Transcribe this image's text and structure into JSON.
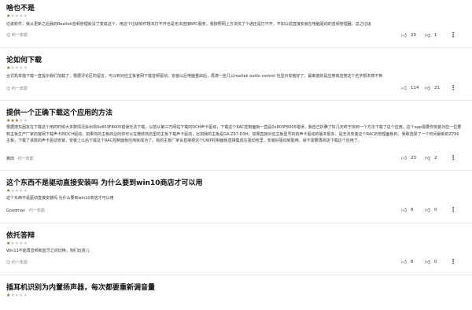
{
  "reviews": [
    {
      "title": "啥也不是",
      "rating": 1,
      "body": "垃圾软件，我从更新之后我的Realtek音频管理就没了变成这个，用这个垃圾软件根本打不开也是无法连接RPC服务，我按照网上方法找了个通还是打不开，不如以前直接安装在电脑驱动的音频管理器，总之垃圾",
      "author": "",
      "time": "约一年前",
      "likes": "20",
      "dislikes": "1"
    },
    {
      "title": "论如何下载",
      "rating": 1,
      "body": "台式机单独下载一直提示我们加载了，根据评论区的留言，可以到对应主板官网下载音频驱动，安装以后电脑重启后，再搜一些几公realtek audio control 也显示安装好了。最离谱的是应用商店搜这个名字根本搜不到",
      "author": "",
      "time": "约一年前",
      "likes": "114",
      "dislikes": "21"
    },
    {
      "title": "提供一个正确下载这个应用的方法",
      "rating": 3,
      "body": "根据搜东困友在下载这个用的时候大多数情况会出现0x803F8005错误无法下载，以前从第三方网站下载的DCH声卡驱动，下载这个RAC控制面板一直是0x803F8005错误，我自己折腾了好几天终于找到一个方法下载了这个应用。这个app需要你安装对应一位要到主板生产厂家的官网下载声卡的DCH驱动，如果你的主板商业的你可以在微软商店里的主板下载声卡驱动，比如我的主板是GA-Z97-D3H，如果直接对应主板型号的的声卡驱动的版本很多，是无法安装这个RAC的管理面板的，我取选择了一个时间最新的Z790主板，下载了该款的声卡驱动安装，安装上以后下载这个RAC控制面板应用就成功了。有的主板厂家会直接把这个UWP控制面板直接集成在驱动包里，安装好驱动就能用，就不需要再商店下载这个应用了。",
      "author": "冀田",
      "time": "约一年前",
      "likes": "23",
      "dislikes": "2"
    },
    {
      "title": "这个东西不是驱动直接安装吗 为什么要到win10商店才可以用",
      "rating": 1,
      "body": "这个东西不是驱动直接安装吗 为什么要到win10商店才可以用",
      "author": "Goodman",
      "time": "约一年前",
      "likes": "8",
      "dislikes": "0"
    },
    {
      "title": "依托答辩",
      "rating": 1,
      "body": "Win11不能再音频和蓝牙之间切换，狗们玩意儿",
      "author": "",
      "time": "约一年前",
      "likes": "6",
      "dislikes": "0"
    },
    {
      "title": "插耳机识别为内置扬声器，每次都要重新调音量",
      "rating": 1,
      "body": "",
      "author": "",
      "time": "",
      "likes": "",
      "dislikes": ""
    }
  ],
  "icons": {
    "star": "★",
    "like": "thumbs-up-icon",
    "dislike": "thumbs-down-icon",
    "more": "more-icon"
  }
}
